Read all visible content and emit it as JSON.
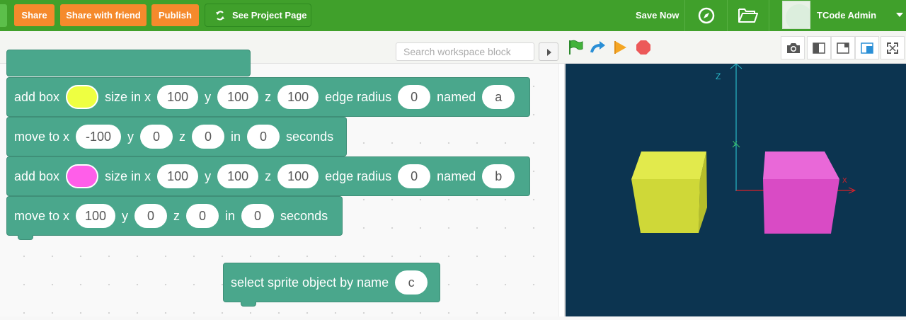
{
  "toolbar": {
    "share": "Share",
    "share_friend": "Share with friend",
    "publish": "Publish",
    "project_page": "See Project Page",
    "save_now": "Save Now",
    "user_name": "TCode Admin"
  },
  "workspace": {
    "search_placeholder": "Search workspace block",
    "blocks": [
      {
        "kind": "add_box",
        "label": "add box",
        "color": "#eeff41",
        "size_label": "size in x",
        "x": "100",
        "y_label": "y",
        "y": "100",
        "z_label": "z",
        "z": "100",
        "edge_label": "edge radius",
        "edge": "0",
        "named_label": "named",
        "name": "a"
      },
      {
        "kind": "move",
        "label": "move to x",
        "x": "-100",
        "y_label": "y",
        "y": "0",
        "z_label": "z",
        "z": "0",
        "in_label": "in",
        "in": "0",
        "seconds_label": "seconds"
      },
      {
        "kind": "add_box",
        "label": "add box",
        "color": "#ff5ee9",
        "size_label": "size in x",
        "x": "100",
        "y_label": "y",
        "y": "100",
        "z_label": "z",
        "z": "100",
        "edge_label": "edge radius",
        "edge": "0",
        "named_label": "named",
        "name": "b"
      },
      {
        "kind": "move",
        "label": "move to x",
        "x": "100",
        "y_label": "y",
        "y": "0",
        "z_label": "z",
        "z": "0",
        "in_label": "in",
        "in": "0",
        "seconds_label": "seconds"
      }
    ],
    "select_block": {
      "label": "select sprite object by name",
      "value": "c"
    }
  },
  "stage": {
    "background": "#0c3450",
    "axis_z": "Z",
    "axis_y": "Y",
    "axis_x": "X",
    "box_a_color": "#d9e33a",
    "box_b_color": "#e056cd"
  },
  "icons": [
    "sync-icon",
    "compass-icon",
    "folder-open-icon",
    "green-flag-icon",
    "redo-arrow-icon",
    "step-play-icon",
    "stop-icon",
    "camera-icon",
    "layout-left-icon",
    "layout-right-icon",
    "layout-small-stage-icon",
    "fullscreen-icon"
  ]
}
